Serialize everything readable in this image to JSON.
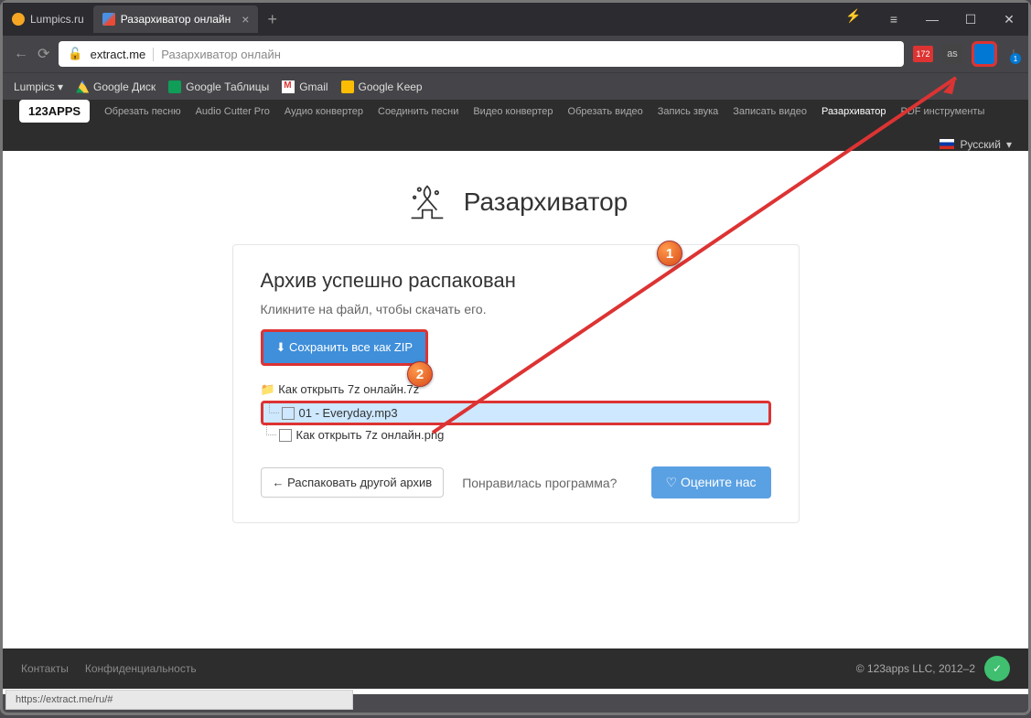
{
  "tabs": {
    "inactive": "Lumpics.ru",
    "active": "Разархиватор онлайн"
  },
  "address": {
    "domain": "extract.me",
    "title": "Разархиватор онлайн"
  },
  "extBadge": "172",
  "dlBadge": "1",
  "bookmarks": {
    "b0": "Lumpics ▾",
    "b1": "Google Диск",
    "b2": "Google Таблицы",
    "b3": "Gmail",
    "b4": "Google Keep"
  },
  "sitenav": {
    "logo": "123APPS",
    "n0": "Обрезать песню",
    "n1": "Audio Cutter Pro",
    "n2": "Аудио конвертер",
    "n3": "Соединить песни",
    "n4": "Видео конвертер",
    "n5": "Обрезать видео",
    "n6": "Запись звука",
    "n7": "Записать видео",
    "n8": "Разархиватор",
    "n9": "PDF инструменты",
    "lang": "Русский"
  },
  "hero": "Разархиватор",
  "panel": {
    "h": "Архив успешно распакован",
    "sub": "Кликните на файл, чтобы скачать его.",
    "zip": "Сохранить все как ZIP",
    "root": "📁 Как открыть 7z онлайн.7z",
    "f1": "01 - Everyday.mp3",
    "f2": "Как открыть 7z онлайн.png",
    "another": "Распаковать другой архив",
    "like": "Понравилась программа?",
    "rate": "Оцените нас"
  },
  "footer": {
    "l1": "Контакты",
    "l2": "Конфиденциальность",
    "copy": "© 123apps LLC, 2012–2"
  },
  "status": "https://extract.me/ru/#",
  "callouts": {
    "c1": "1",
    "c2": "2"
  }
}
